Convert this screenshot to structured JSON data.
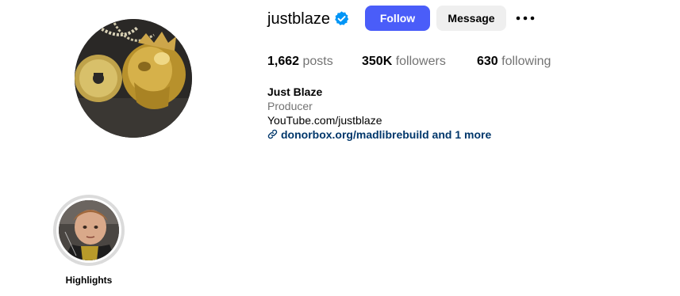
{
  "profile": {
    "username": "justblaze",
    "verified": true,
    "avatar_icon": "profile-picture",
    "verified_icon": "verified-badge-icon"
  },
  "actions": {
    "follow_label": "Follow",
    "message_label": "Message",
    "more_icon": "more-options-icon"
  },
  "stats": {
    "posts_count": "1,662",
    "posts_label": "posts",
    "followers_count": "350K",
    "followers_label": "followers",
    "following_count": "630",
    "following_label": "following"
  },
  "bio": {
    "name": "Just Blaze",
    "category": "Producer",
    "text": "YouTube.com/justblaze",
    "link_text": "donorbox.org/madlibrebuild and 1 more",
    "link_icon": "link-icon"
  },
  "highlights": [
    {
      "label": "Highlights"
    }
  ],
  "colors": {
    "follow_button": "#4a5df9",
    "message_button": "#efefef",
    "verified_blue": "#0095f6",
    "link_blue": "#00376b",
    "secondary_text": "#737373"
  }
}
